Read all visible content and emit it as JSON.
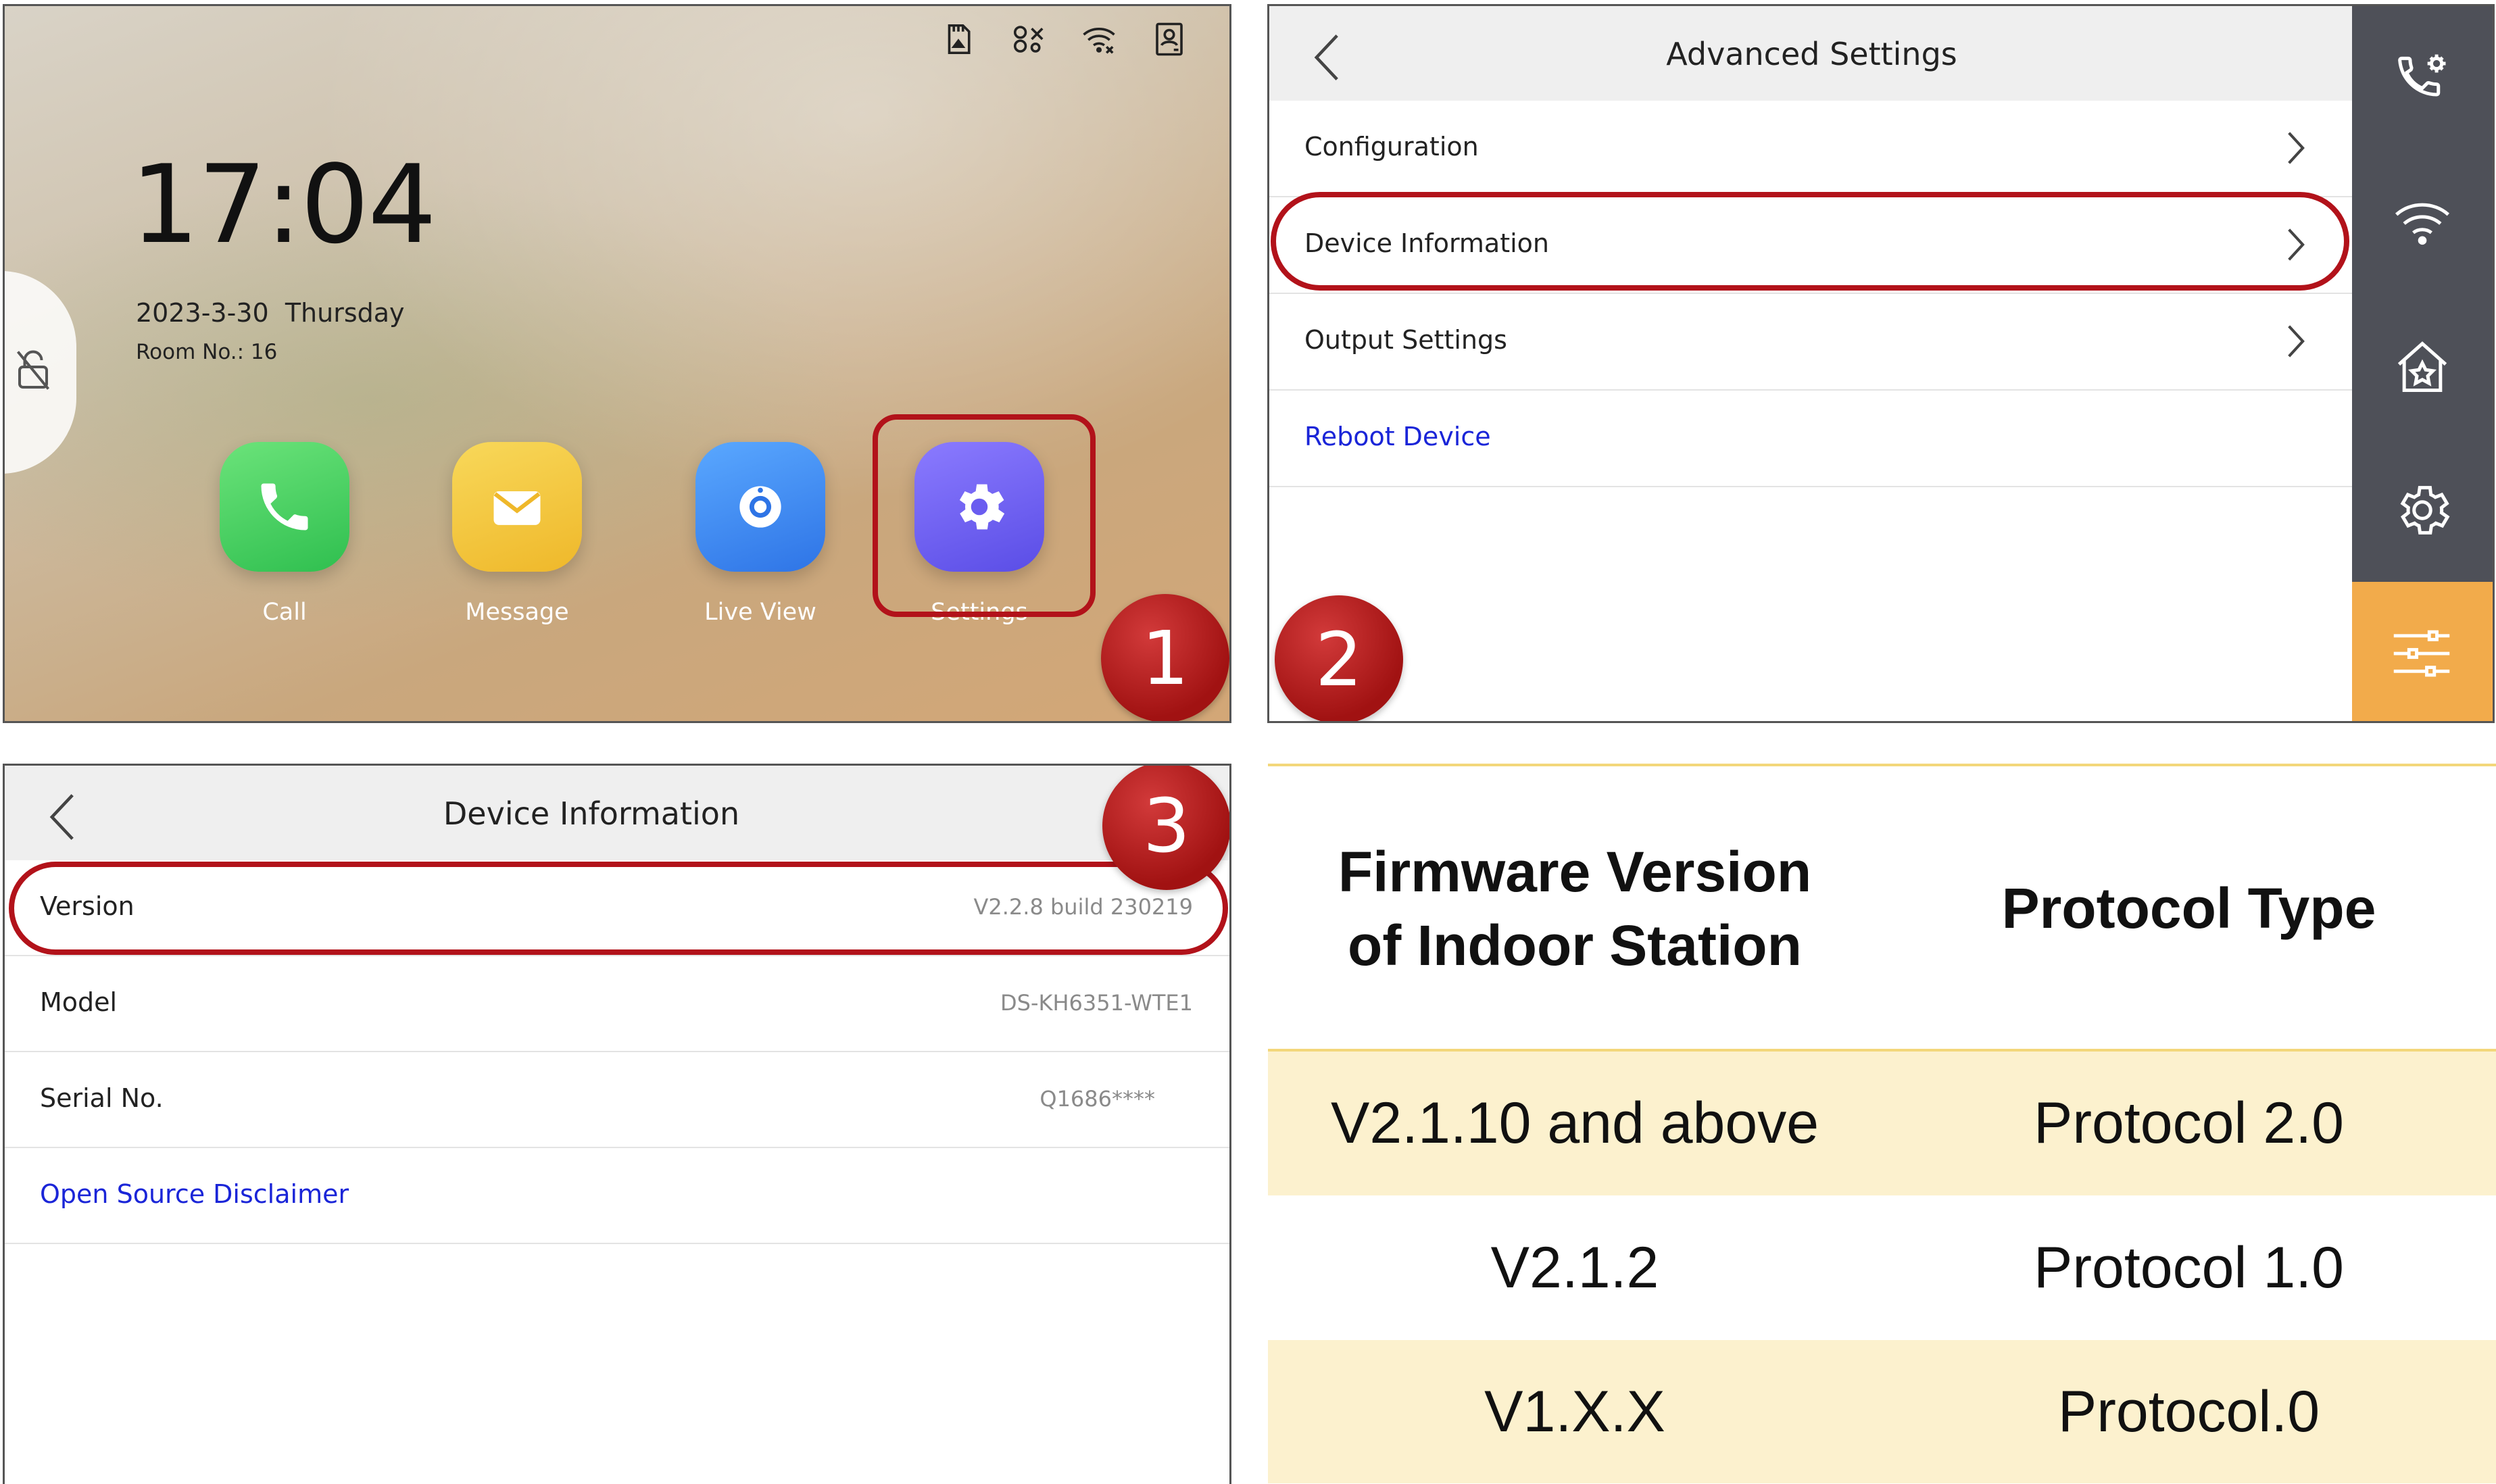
{
  "home": {
    "time": "17:04",
    "date": "2023-3-30  Thursday",
    "room": "Room No.: 16",
    "status_icons": [
      "sd-card-icon",
      "link-off-icon",
      "wifi-icon",
      "person-card-icon"
    ],
    "apps": [
      {
        "label": "Call",
        "icon": "phone-icon",
        "color": "#3fcf5e"
      },
      {
        "label": "Message",
        "icon": "envelope-icon",
        "color": "#f4c63a"
      },
      {
        "label": "Live View",
        "icon": "camera-icon",
        "color": "#3d8ff0"
      },
      {
        "label": "Settings",
        "icon": "gear-icon",
        "color": "#6a5cf0"
      }
    ],
    "step": "1"
  },
  "advanced": {
    "title": "Advanced Settings",
    "items": [
      {
        "label": "Configuration"
      },
      {
        "label": "Device Information"
      },
      {
        "label": "Output Settings"
      },
      {
        "label": "Reboot Device"
      }
    ],
    "rail_icons": [
      "call-settings-icon",
      "wifi-icon",
      "home-star-icon",
      "gear-icon",
      "sliders-icon"
    ],
    "step": "2"
  },
  "device_info": {
    "title": "Device Information",
    "rows": [
      {
        "key": "Version",
        "value": "V2.2.8 build 230219"
      },
      {
        "key": "Model",
        "value": "DS-KH6351-WTE1"
      },
      {
        "key": "Serial No.",
        "value": "Q1686****"
      },
      {
        "key": "Open Source Disclaimer",
        "value": ""
      }
    ],
    "step": "3"
  },
  "table": {
    "headers": [
      "Firmware Version\nof Indoor Station",
      "Protocol Type"
    ],
    "rows": [
      [
        "V2.1.10 and above",
        "Protocol 2.0"
      ],
      [
        "V2.1.2",
        "Protocol 1.0"
      ],
      [
        "V1.X.X",
        "Protocol.0"
      ]
    ]
  },
  "colors": {
    "highlight_ring": "#b2121a",
    "link_blue": "#1a25d8",
    "rail_dark": "#4e5058",
    "rail_active": "#f2ab4b",
    "table_shade": "#fcf1ce"
  }
}
